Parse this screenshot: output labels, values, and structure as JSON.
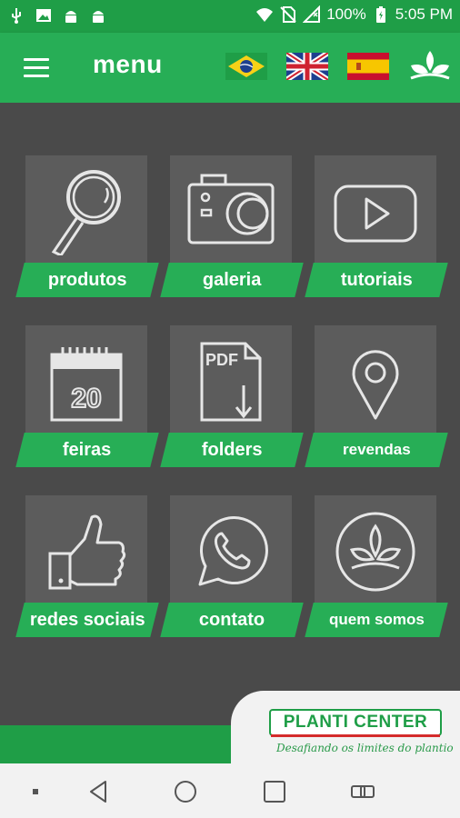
{
  "status_bar": {
    "battery": "100%",
    "time": "5:05 PM"
  },
  "header": {
    "title": "menu",
    "flags": [
      "portuguese-flag",
      "english-flag",
      "spanish-flag"
    ]
  },
  "tiles": [
    {
      "label": "produtos",
      "icon": "magnifier-icon"
    },
    {
      "label": "galeria",
      "icon": "camera-icon"
    },
    {
      "label": "tutoriais",
      "icon": "play-icon"
    },
    {
      "label": "feiras",
      "icon": "calendar-icon",
      "calendar_day": "20"
    },
    {
      "label": "folders",
      "icon": "pdf-icon",
      "pdf_text": "PDF"
    },
    {
      "label": "revendas",
      "icon": "location-pin-icon"
    },
    {
      "label": "redes sociais",
      "icon": "thumbs-up-icon"
    },
    {
      "label": "contato",
      "icon": "whatsapp-icon"
    },
    {
      "label": "quem somos",
      "icon": "leaf-logo-icon"
    }
  ],
  "brand": {
    "name": "PLANTI CENTER",
    "tagline": "Desafiando os limites do plantio"
  },
  "colors": {
    "green": "#27ae56",
    "dark_green": "#1f9e47",
    "background": "#4a4a4a",
    "tile": "#5c5c5c"
  }
}
